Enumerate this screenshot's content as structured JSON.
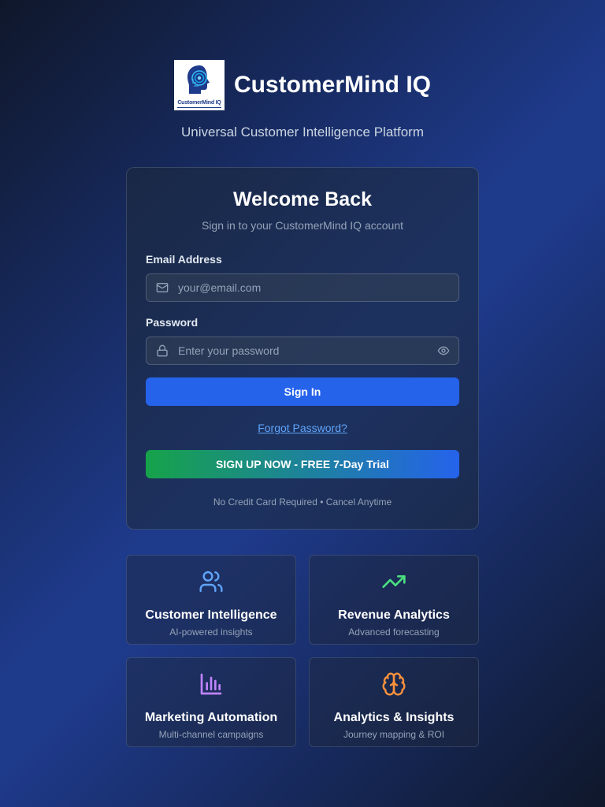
{
  "brand": {
    "name": "CustomerMind IQ",
    "logo_text": "CustomerMind IQ",
    "tagline": "Universal Customer Intelligence Platform"
  },
  "login": {
    "title": "Welcome Back",
    "subtitle": "Sign in to your CustomerMind IQ account",
    "email": {
      "label": "Email Address",
      "placeholder": "your@email.com",
      "value": "",
      "icon": "mail-icon"
    },
    "password": {
      "label": "Password",
      "placeholder": "Enter your password",
      "value": "",
      "icon": "lock-icon",
      "toggle_icon": "eye-icon"
    },
    "signin_label": "Sign In",
    "forgot_label": "Forgot Password?",
    "signup_label": "SIGN UP NOW - FREE 7-Day Trial",
    "fineprint": "No Credit Card Required • Cancel Anytime"
  },
  "features": [
    {
      "title": "Customer Intelligence",
      "desc": "AI-powered insights",
      "icon": "users-icon",
      "color": "#60a5fa"
    },
    {
      "title": "Revenue Analytics",
      "desc": "Advanced forecasting",
      "icon": "trending-up-icon",
      "color": "#4ade80"
    },
    {
      "title": "Marketing Automation",
      "desc": "Multi-channel campaigns",
      "icon": "bar-chart-icon",
      "color": "#c084fc"
    },
    {
      "title": "Analytics & Insights",
      "desc": "Journey mapping & ROI",
      "icon": "brain-icon",
      "color": "#fb923c"
    }
  ],
  "colors": {
    "primary": "#2563eb",
    "link": "#60a5fa",
    "signup_gradient_start": "#16a34a",
    "signup_gradient_end": "#2563eb"
  }
}
